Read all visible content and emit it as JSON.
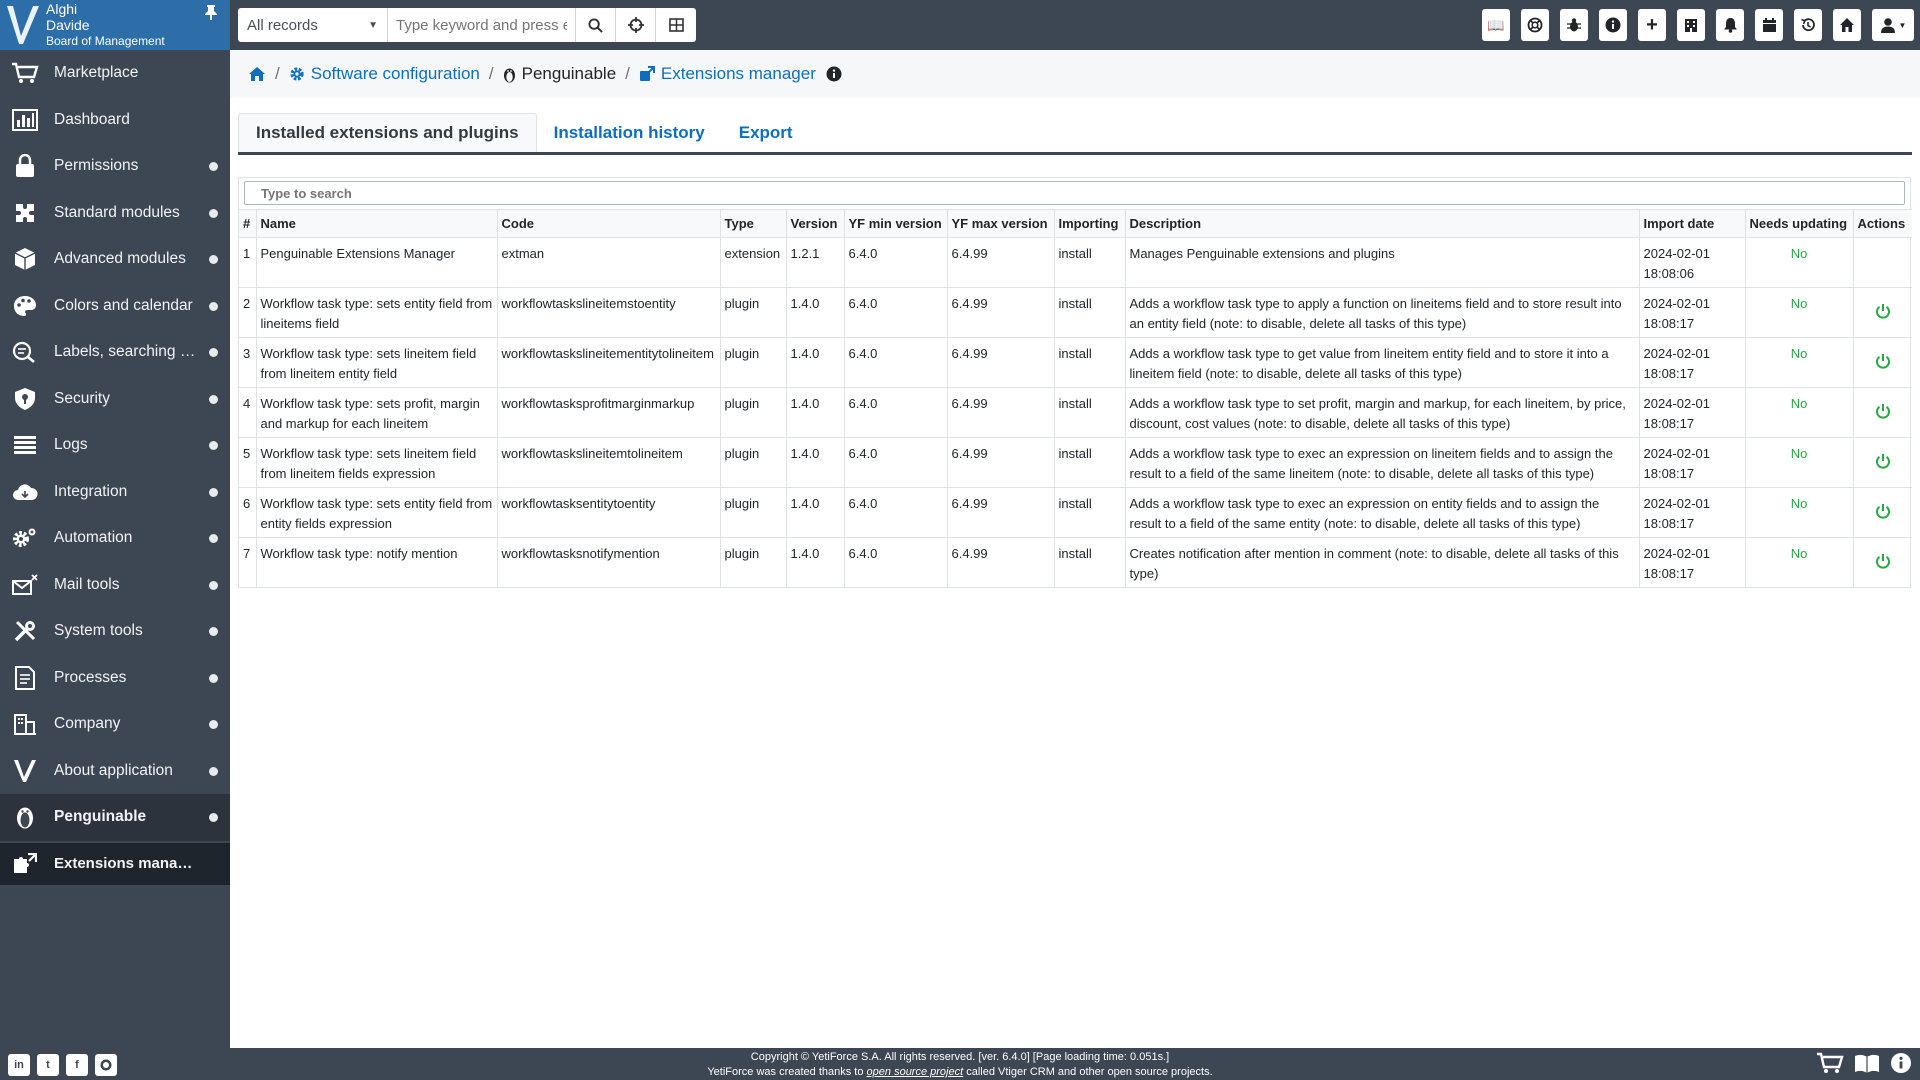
{
  "user": {
    "name1": "Alghi",
    "name2": "Davide",
    "role": "Board of Management"
  },
  "sidebar": {
    "items": [
      {
        "label": "Marketplace",
        "icon": "cart-icon",
        "dot": false
      },
      {
        "label": "Dashboard",
        "icon": "dashboard-icon",
        "dot": false
      },
      {
        "label": "Permissions",
        "icon": "lock-icon",
        "dot": true
      },
      {
        "label": "Standard modules",
        "icon": "puzzle-icon",
        "dot": true
      },
      {
        "label": "Advanced modules",
        "icon": "cube-icon",
        "dot": true
      },
      {
        "label": "Colors and calendar",
        "icon": "palette-icon",
        "dot": true
      },
      {
        "label": "Labels, searching a...",
        "icon": "search-list-icon",
        "dot": true
      },
      {
        "label": "Security",
        "icon": "shield-icon",
        "dot": true
      },
      {
        "label": "Logs",
        "icon": "logs-icon",
        "dot": true
      },
      {
        "label": "Integration",
        "icon": "cloud-icon",
        "dot": true
      },
      {
        "label": "Automation",
        "icon": "gears-icon",
        "dot": true
      },
      {
        "label": "Mail tools",
        "icon": "mail-icon",
        "dot": true
      },
      {
        "label": "System tools",
        "icon": "tools-icon",
        "dot": true
      },
      {
        "label": "Processes",
        "icon": "processes-icon",
        "dot": true
      },
      {
        "label": "Company",
        "icon": "company-icon",
        "dot": true
      },
      {
        "label": "About application",
        "icon": "yeti-logo-icon",
        "dot": true
      },
      {
        "label": "Penguinable",
        "icon": "penguin-icon",
        "dot": true
      }
    ],
    "sub_item": "Extensions manager"
  },
  "topbar": {
    "records_select": "All records",
    "keyword_placeholder": "Type keyword and press enter"
  },
  "breadcrumb": {
    "software_configuration": "Software configuration",
    "penguinable": "Penguinable",
    "extensions_manager": "Extensions manager"
  },
  "tabs": [
    {
      "label": "Installed extensions and plugins",
      "active": true
    },
    {
      "label": "Installation history",
      "active": false
    },
    {
      "label": "Export",
      "active": false
    }
  ],
  "table": {
    "search_placeholder": "Type to search",
    "headers": [
      "#",
      "Name",
      "Code",
      "Type",
      "Version",
      "YF min version",
      "YF max version",
      "Importing",
      "Description",
      "Import date",
      "Needs updating",
      "Actions"
    ],
    "rows": [
      {
        "num": "1",
        "name": "Penguinable Extensions Manager",
        "code": "extman",
        "type": "extension",
        "version": "1.2.1",
        "yfmin": "6.4.0",
        "yfmax": "6.4.99",
        "importing": "install",
        "description": "Manages Penguinable extensions and plugins",
        "date": "2024-02-01",
        "time": "18:08:06",
        "needs": "No",
        "action": false
      },
      {
        "num": "2",
        "name": "Workflow task type: sets entity field from lineitems field",
        "code": "workflowtaskslineitemstoentity",
        "type": "plugin",
        "version": "1.4.0",
        "yfmin": "6.4.0",
        "yfmax": "6.4.99",
        "importing": "install",
        "description": "Adds a workflow task type to apply a function on lineitems field and to store result into an entity field (note: to disable, delete all tasks of this type)",
        "date": "2024-02-01",
        "time": "18:08:17",
        "needs": "No",
        "action": true
      },
      {
        "num": "3",
        "name": "Workflow task type: sets lineitem field from lineitem entity field",
        "code": "workflowtaskslineitementitytolineitem",
        "type": "plugin",
        "version": "1.4.0",
        "yfmin": "6.4.0",
        "yfmax": "6.4.99",
        "importing": "install",
        "description": "Adds a workflow task type to get value from lineitem entity field and to store it into a lineitem field (note: to disable, delete all tasks of this type)",
        "date": "2024-02-01",
        "time": "18:08:17",
        "needs": "No",
        "action": true
      },
      {
        "num": "4",
        "name": "Workflow task type: sets profit, margin and markup for each lineitem",
        "code": "workflowtasksprofitmarginmarkup",
        "type": "plugin",
        "version": "1.4.0",
        "yfmin": "6.4.0",
        "yfmax": "6.4.99",
        "importing": "install",
        "description": "Adds a workflow task type to set profit, margin and markup, for each lineitem, by price, discount, cost values (note: to disable, delete all tasks of this type)",
        "date": "2024-02-01",
        "time": "18:08:17",
        "needs": "No",
        "action": true
      },
      {
        "num": "5",
        "name": "Workflow task type: sets lineitem field from lineitem fields expression",
        "code": "workflowtaskslineitemtolineitem",
        "type": "plugin",
        "version": "1.4.0",
        "yfmin": "6.4.0",
        "yfmax": "6.4.99",
        "importing": "install",
        "description": "Adds a workflow task type to exec an expression on lineitem fields and to assign the result to a field of the same lineitem (note: to disable, delete all tasks of this type)",
        "date": "2024-02-01",
        "time": "18:08:17",
        "needs": "No",
        "action": true
      },
      {
        "num": "6",
        "name": "Workflow task type: sets entity field from entity fields expression",
        "code": "workflowtasksentitytoentity",
        "type": "plugin",
        "version": "1.4.0",
        "yfmin": "6.4.0",
        "yfmax": "6.4.99",
        "importing": "install",
        "description": "Adds a workflow task type to exec an expression on entity fields and to assign the result to a field of the same entity (note: to disable, delete all tasks of this type)",
        "date": "2024-02-01",
        "time": "18:08:17",
        "needs": "No",
        "action": true
      },
      {
        "num": "7",
        "name": "Workflow task type: notify mention",
        "code": "workflowtasksnotifymention",
        "type": "plugin",
        "version": "1.4.0",
        "yfmin": "6.4.0",
        "yfmax": "6.4.99",
        "importing": "install",
        "description": "Creates notification after mention in comment (note: to disable, delete all tasks of this type)",
        "date": "2024-02-01",
        "time": "18:08:17",
        "needs": "No",
        "action": true
      }
    ]
  },
  "footer": {
    "line1": "Copyright © YetiForce S.A. All rights reserved. [ver. 6.4.0] [Page loading time: 0.051s.]",
    "line2_pre": "YetiForce was created thanks to ",
    "line2_link": "open source project",
    "line2_post": " called Vtiger CRM and other open source projects."
  },
  "colors": {
    "sidebar": "#3d4653",
    "user_panel": "#2d6ea8",
    "link": "#0d6ebf",
    "success": "#28a745"
  }
}
